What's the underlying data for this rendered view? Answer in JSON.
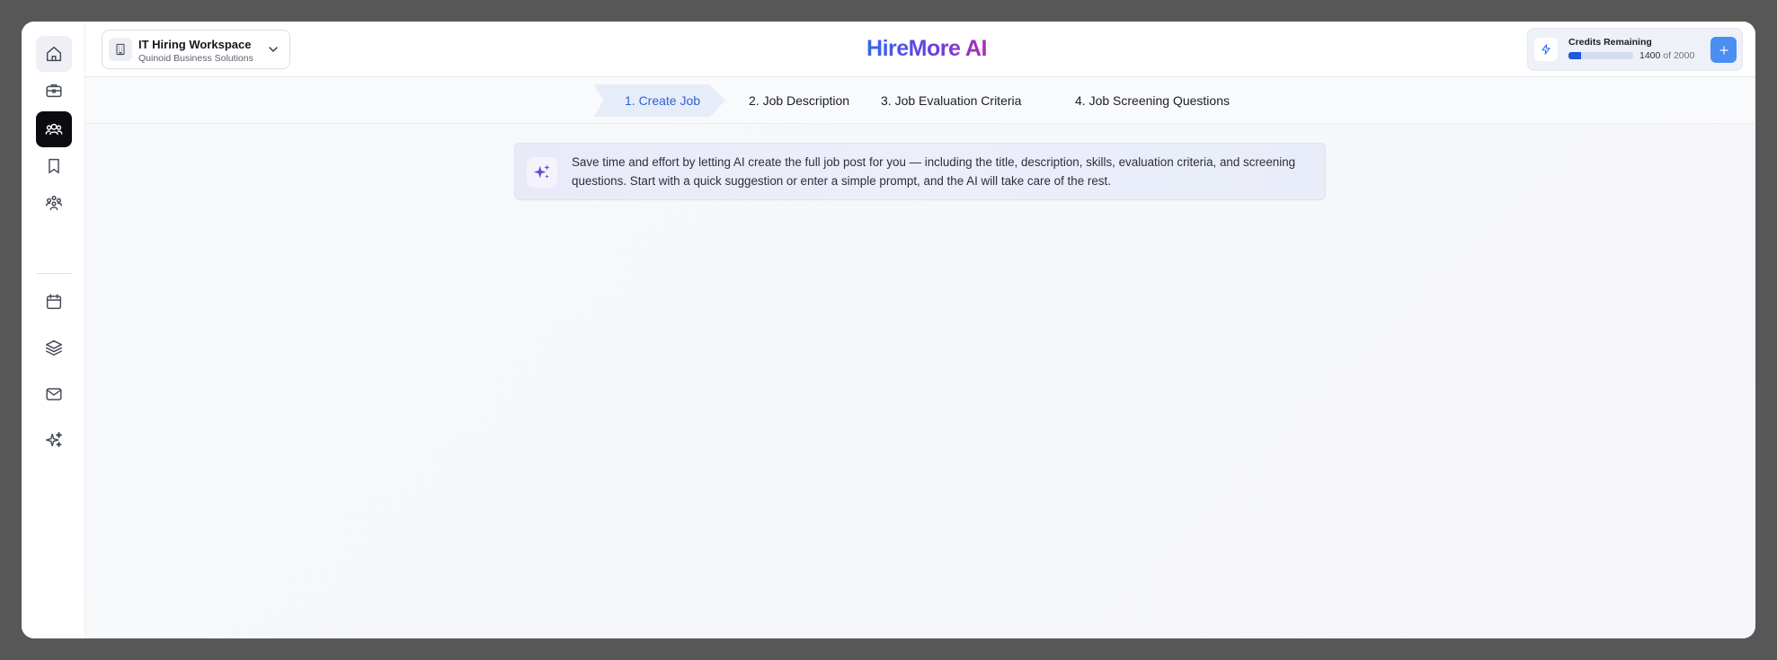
{
  "workspace": {
    "name": "IT Hiring Workspace",
    "organization": "Quinoid Business Solutions"
  },
  "brand": {
    "title": "HireMore AI",
    "gradient": [
      "#2f6bf0",
      "#6a3fe0",
      "#b02ea8"
    ]
  },
  "credits": {
    "label": "Credits Remaining",
    "used": "1400",
    "of_label": "of",
    "total": "2000",
    "fill_fraction": 0.2
  },
  "sidebar": {
    "items": [
      {
        "name": "home",
        "icon": "home-icon"
      },
      {
        "name": "jobs",
        "icon": "briefcase-icon"
      },
      {
        "name": "candidates",
        "icon": "users-icon",
        "active": true
      },
      {
        "name": "saved",
        "icon": "bookmark-icon"
      },
      {
        "name": "teams",
        "icon": "team-icon"
      },
      {
        "name": "calendar",
        "icon": "calendar-icon"
      },
      {
        "name": "templates",
        "icon": "layers-icon"
      },
      {
        "name": "mail",
        "icon": "mail-icon"
      },
      {
        "name": "ai",
        "icon": "sparkles-icon"
      }
    ]
  },
  "steps": [
    {
      "label": "1. Create Job",
      "active": true
    },
    {
      "label": "2. Job Description"
    },
    {
      "label": "3. Job Evaluation Criteria"
    },
    {
      "label": "4. Job Screening Questions"
    }
  ],
  "banner": {
    "icon": "sparkles-icon",
    "text": "Save time and effort by letting AI create the full job post for you — including the title, description, skills, evaluation criteria, and screening questions. Start with a quick suggestion or enter a simple prompt, and the AI will take care of the rest."
  },
  "colors": {
    "accent": "#2b63d9",
    "active_nav": "#0b0c10",
    "credits_fill": "#1f58d8",
    "add_button": "#4a8ef2"
  }
}
